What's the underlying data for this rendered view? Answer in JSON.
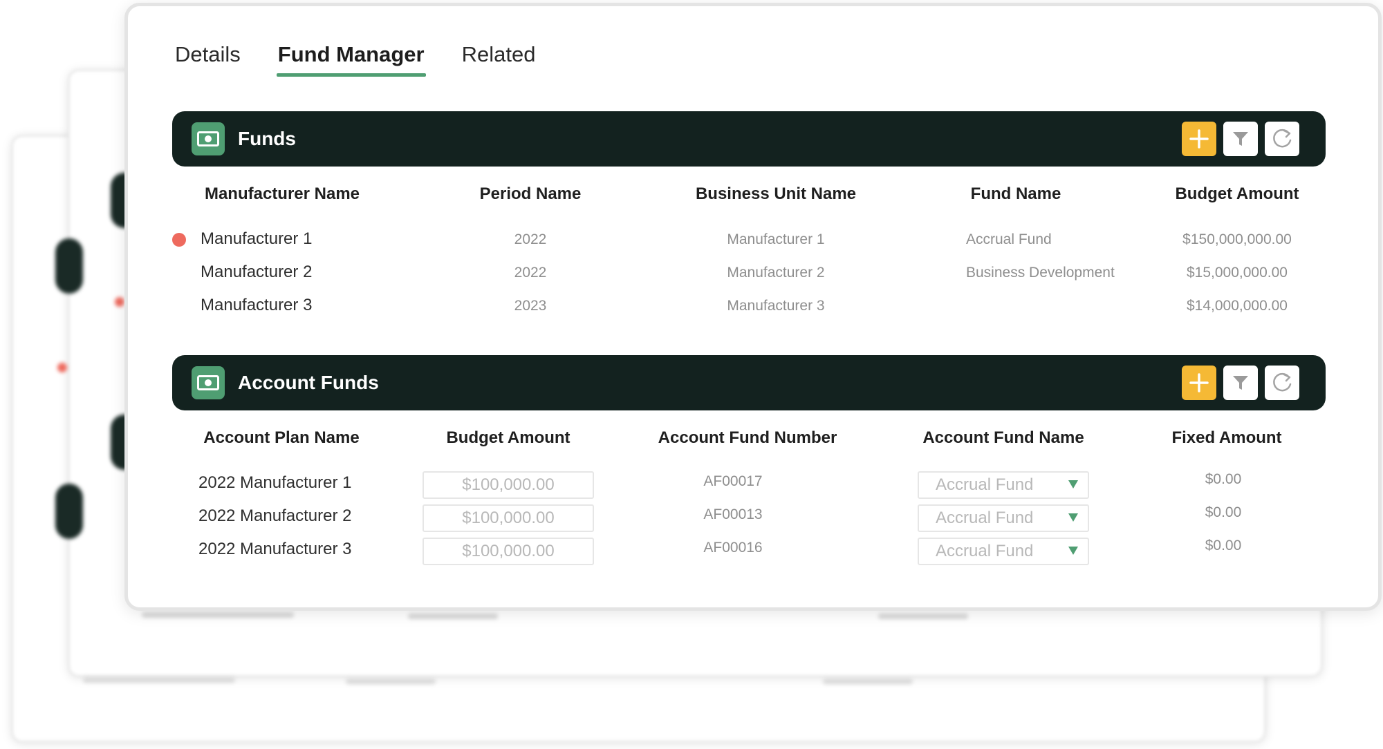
{
  "tabs": [
    {
      "label": "Details",
      "active": false
    },
    {
      "label": "Fund Manager",
      "active": true
    },
    {
      "label": "Related",
      "active": false
    }
  ],
  "funds": {
    "title": "Funds",
    "icon": "money-icon",
    "columns": [
      "Manufacturer Name",
      "Period Name",
      "Business Unit Name",
      "Fund Name",
      "Budget Amount"
    ],
    "rows": [
      {
        "manufacturer": "Manufacturer 1",
        "period": "2022",
        "business_unit": "Manufacturer 1",
        "fund_name": "Accrual Fund",
        "budget": "$150,000,000.00",
        "flagged": true
      },
      {
        "manufacturer": "Manufacturer 2",
        "period": "2022",
        "business_unit": "Manufacturer 2",
        "fund_name": "Business Development",
        "budget": "$15,000,000.00",
        "flagged": false
      },
      {
        "manufacturer": "Manufacturer 3",
        "period": "2023",
        "business_unit": "Manufacturer 3",
        "fund_name": "",
        "budget": "$14,000,000.00",
        "flagged": false
      }
    ]
  },
  "account_funds": {
    "title": "Account Funds",
    "icon": "money-icon",
    "columns": [
      "Account Plan Name",
      "Budget Amount",
      "Account Fund Number",
      "Account Fund Name",
      "Fixed Amount"
    ],
    "rows": [
      {
        "plan": "2022 Manufacturer 1",
        "budget": "$100,000.00",
        "number": "AF00017",
        "fund_name": "Accrual Fund",
        "fixed": "$0.00"
      },
      {
        "plan": "2022 Manufacturer 2",
        "budget": "$100,000.00",
        "number": "AF00013",
        "fund_name": "Accrual Fund",
        "fixed": "$0.00"
      },
      {
        "plan": "2022 Manufacturer 3",
        "budget": "$100,000.00",
        "number": "AF00016",
        "fund_name": "Accrual Fund",
        "fixed": "$0.00"
      }
    ]
  },
  "actions": {
    "add_icon": "plus-icon",
    "filter_icon": "filter-icon",
    "refresh_icon": "refresh-icon"
  },
  "colors": {
    "accent_green": "#4f9e72",
    "bar_dark": "#13221f",
    "add_yellow": "#f5b935",
    "status_red": "#ee6a5e"
  }
}
